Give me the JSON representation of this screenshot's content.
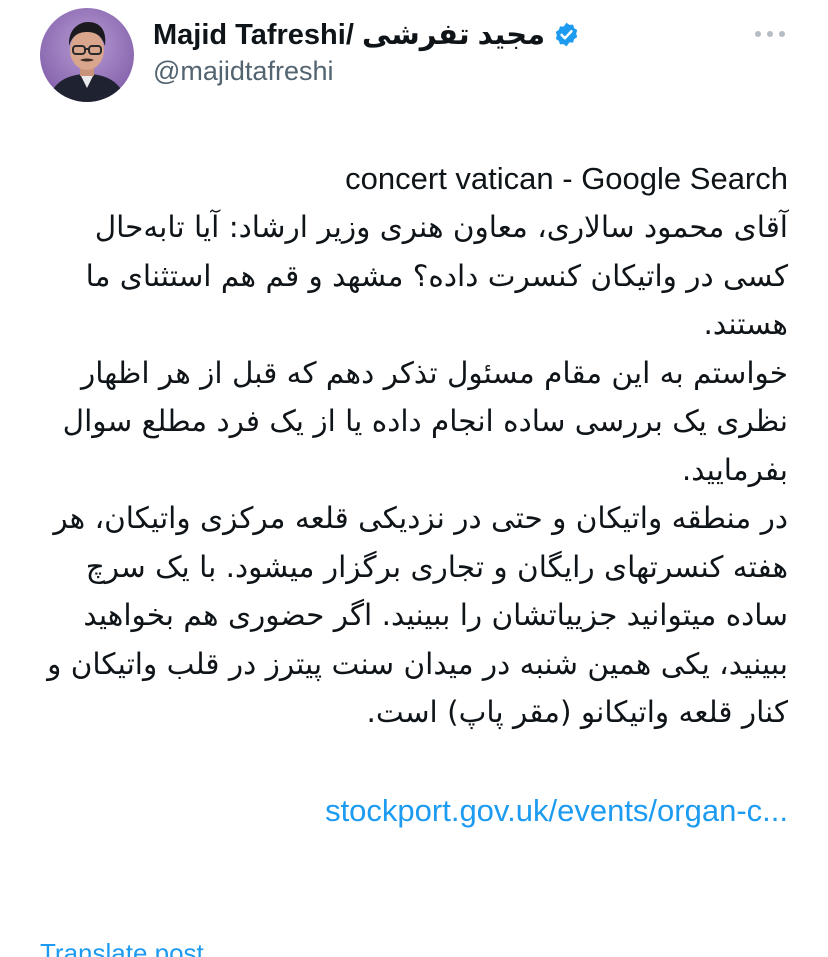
{
  "author": {
    "display_name": "Majid Tafreshi/ مجید تفرشی",
    "handle": "@majidtafreshi",
    "verified_icon": "verified-badge-icon",
    "avatar": "avatar"
  },
  "menu": {
    "icon": "more-dots-icon"
  },
  "tweet": {
    "headline": "concert vatican - Google Search",
    "paragraphs": [
      "آقای محمود سالاری، معاون هنری وزیر ارشاد: آیا تابه‌حال کسی در واتیکان کنسرت داده؟ مشهد و قم هم استثنای ما هستند.",
      "خواستم به این مقام مسئول تذکر دهم که قبل از هر اظهار نظری یک بررسی ساده انجام داده یا از یک فرد مطلع سوال بفرمایید.",
      "در منطقه واتیکان و حتی در نزدیکی قلعه مرکزی واتیکان، هر هفته کنسرتهای رایگان و تجاری برگزار میشود. با یک سرچ ساده میتوانید جزییاتشان را ببینید. اگر حضوری هم بخواهید ببینید، یکی همین شنبه در میدان سنت پیترز در قلب واتیکان و کنار قلعه واتیکانو (مقر پاپ) است."
    ],
    "link_text": "stockport.gov.uk/events/organ-c..."
  },
  "actions": {
    "translate_label": "Translate post"
  },
  "colors": {
    "text": "#0f1419",
    "secondary": "#536471",
    "link": "#1d9bf0",
    "verified": "#1d9bf0"
  }
}
